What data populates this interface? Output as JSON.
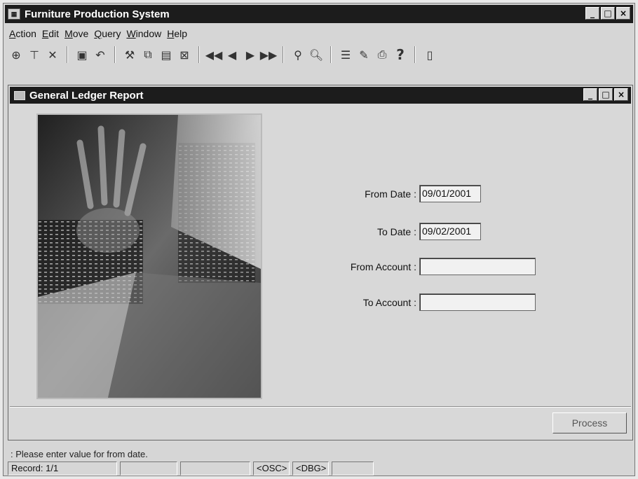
{
  "app": {
    "title": "Furniture Production System",
    "icon": "app-icon",
    "window_buttons": [
      "_",
      "□",
      "×"
    ]
  },
  "menu": [
    "Action",
    "Edit",
    "Move",
    "Query",
    "Window",
    "Help"
  ],
  "toolbar": {
    "groups": [
      [
        "new-record-icon",
        "filter-icon",
        "clear-filter-icon"
      ],
      [
        "save-icon",
        "undo-icon"
      ],
      [
        "tools-icon",
        "copy-icon",
        "paste-icon",
        "delete-icon"
      ],
      [
        "first-record-icon",
        "previous-record-icon",
        "next-record-icon",
        "last-record-icon"
      ],
      [
        "search-icon",
        "zoom-icon"
      ],
      [
        "report-icon",
        "edit-icon",
        "print-icon",
        "help-icon"
      ],
      [
        "exit-icon"
      ]
    ]
  },
  "child_window": {
    "title": "General Ledger Report",
    "icon": "form-icon"
  },
  "form": {
    "from_date_label": "From Date :",
    "from_date_value": "09/01/2001",
    "to_date_label": "To Date :",
    "to_date_value": "09/02/2001",
    "from_account_label": "From Account :",
    "from_account_value": "",
    "to_account_label": "To Account :",
    "to_account_value": ""
  },
  "buttons": {
    "process": "Process"
  },
  "status": {
    "message": ": Please enter value for from date.",
    "record": "Record: 1/1",
    "osc": "<OSC>",
    "dbg": "<DBG>"
  }
}
